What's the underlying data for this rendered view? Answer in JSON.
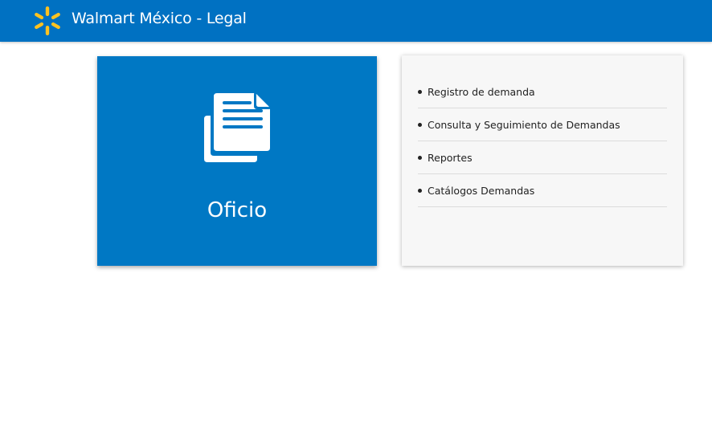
{
  "header": {
    "title": "Walmart México - Legal",
    "background": "#0071c2",
    "logo_icon": "walmart-spark-icon",
    "logo_color": "#ffc220"
  },
  "tile": {
    "label": "Oficio",
    "icon": "documents-icon",
    "background": "#0078c4"
  },
  "menu": {
    "items": [
      {
        "label": "Registro de demanda"
      },
      {
        "label": "Consulta y Seguimiento de Demandas"
      },
      {
        "label": "Reportes"
      },
      {
        "label": "Catálogos Demandas"
      }
    ]
  }
}
